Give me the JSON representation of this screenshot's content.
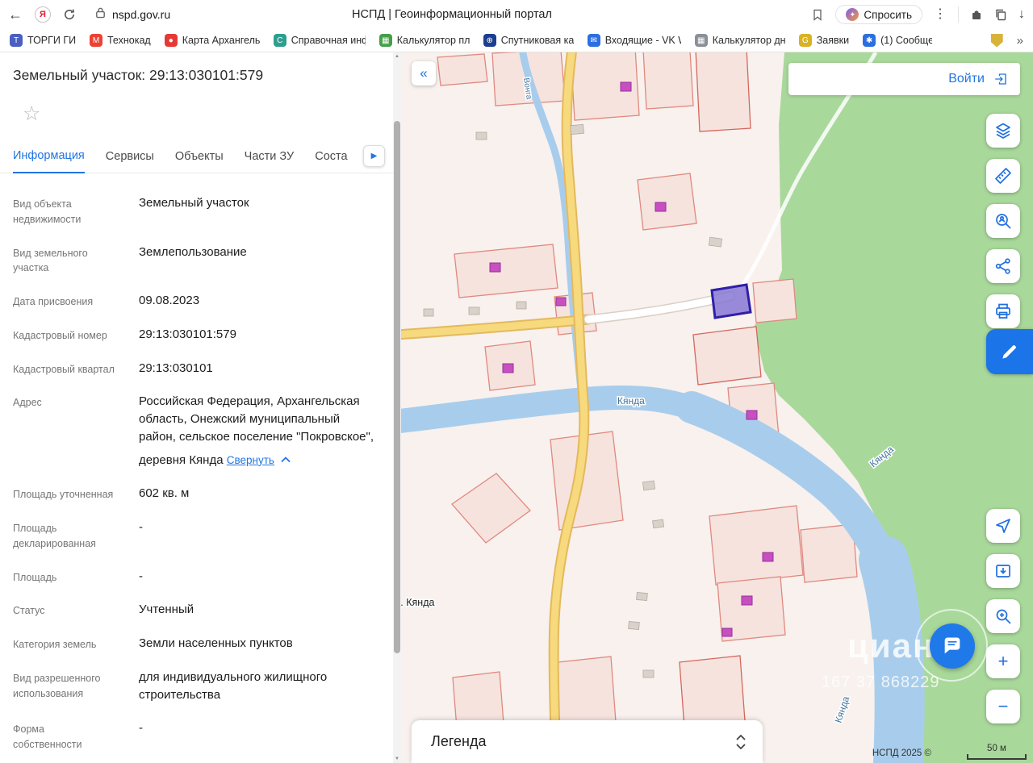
{
  "theme": {
    "accent": "#2374e1",
    "selected_parcel_stroke": "#2f1fa8",
    "selected_parcel_fill": "#7f71d2"
  },
  "browser": {
    "url": "nspd.gov.ru",
    "page_title": "НСПД | Геоинформационный портал",
    "ask_label": "Спросить",
    "glyphs": {
      "back": "←",
      "yandex": "Я",
      "kebab": "⋮",
      "download": "↓",
      "overflow": "»",
      "scroll_up": "▲",
      "scroll_down": "▼"
    },
    "bookmarks": [
      {
        "label": "ТОРГИ ГИС",
        "glyph": "Т",
        "color": "#4a5fc1"
      },
      {
        "label": "Технокад",
        "glyph": "M",
        "color": "#ea4335"
      },
      {
        "label": "Карта Архангельс",
        "glyph": "●",
        "color": "#e53935"
      },
      {
        "label": "Справочная инфо",
        "glyph": "С",
        "color": "#2e9e8f"
      },
      {
        "label": "Калькулятор пло",
        "glyph": "▦",
        "color": "#43a047"
      },
      {
        "label": "Спутниковая кар",
        "glyph": "⊕",
        "color": "#1a3f8f"
      },
      {
        "label": "Входящие - VK W",
        "glyph": "✉",
        "color": "#2b6fe0"
      },
      {
        "label": "Калькулятор дне",
        "glyph": "▦",
        "color": "#8a8f98"
      },
      {
        "label": "Заявки",
        "glyph": "G",
        "color": "#d8b324"
      },
      {
        "label": "(1) Сообще",
        "glyph": "✱",
        "color": "#2b6fe0"
      }
    ]
  },
  "panel": {
    "title": "Земельный участок: 29:13:030101:579",
    "star_glyph": "☆",
    "tabs": [
      {
        "label": "Информация"
      },
      {
        "label": "Сервисы"
      },
      {
        "label": "Объекты"
      },
      {
        "label": "Части ЗУ"
      },
      {
        "label": "Соста"
      }
    ],
    "tabs_arrow_glyph": "▶",
    "fields": [
      {
        "label": "Вид объекта недвижимости",
        "value": "Земельный участок"
      },
      {
        "label": "Вид земельного участка",
        "value": "Землепользование"
      },
      {
        "label": "Дата присвоения",
        "value": "09.08.2023"
      },
      {
        "label": "Кадастровый номер",
        "value": "29:13:030101:579"
      },
      {
        "label": "Кадастровый квартал",
        "value": "29:13:030101"
      },
      {
        "label": "Адрес",
        "value": "Российская Федерация, Архангельская область, Онежский муниципальный район, сельское поселение \"Покровское\", деревня Кянда",
        "collapse_link": "Свернуть"
      },
      {
        "label": "Площадь уточненная",
        "value": "602 кв. м"
      },
      {
        "label": "Площадь декларированная",
        "value": "-"
      },
      {
        "label": "Площадь",
        "value": "-"
      },
      {
        "label": "Статус",
        "value": "Учтенный"
      },
      {
        "label": "Категория земель",
        "value": "Земли населенных пунктов"
      },
      {
        "label": "Вид разрешенного использования",
        "value": "для индивидуального жилищного строительства"
      },
      {
        "label": "Форма собственности",
        "value": "-"
      }
    ]
  },
  "map": {
    "collapse_glyph": "«",
    "login_label": "Войти",
    "legend_label": "Легенда",
    "attribution": "НСПД 2025 ©",
    "scale_label": "50 м",
    "zoom_in": "+",
    "zoom_out": "−",
    "labels": {
      "river_mid": "Кянда",
      "river_bend": "Кянда",
      "river_bottom": "Кянда",
      "settlement": "д. Кянда",
      "stream": "Вонга"
    },
    "watermark": {
      "brand": "циан",
      "id": "167 37 868229"
    }
  }
}
